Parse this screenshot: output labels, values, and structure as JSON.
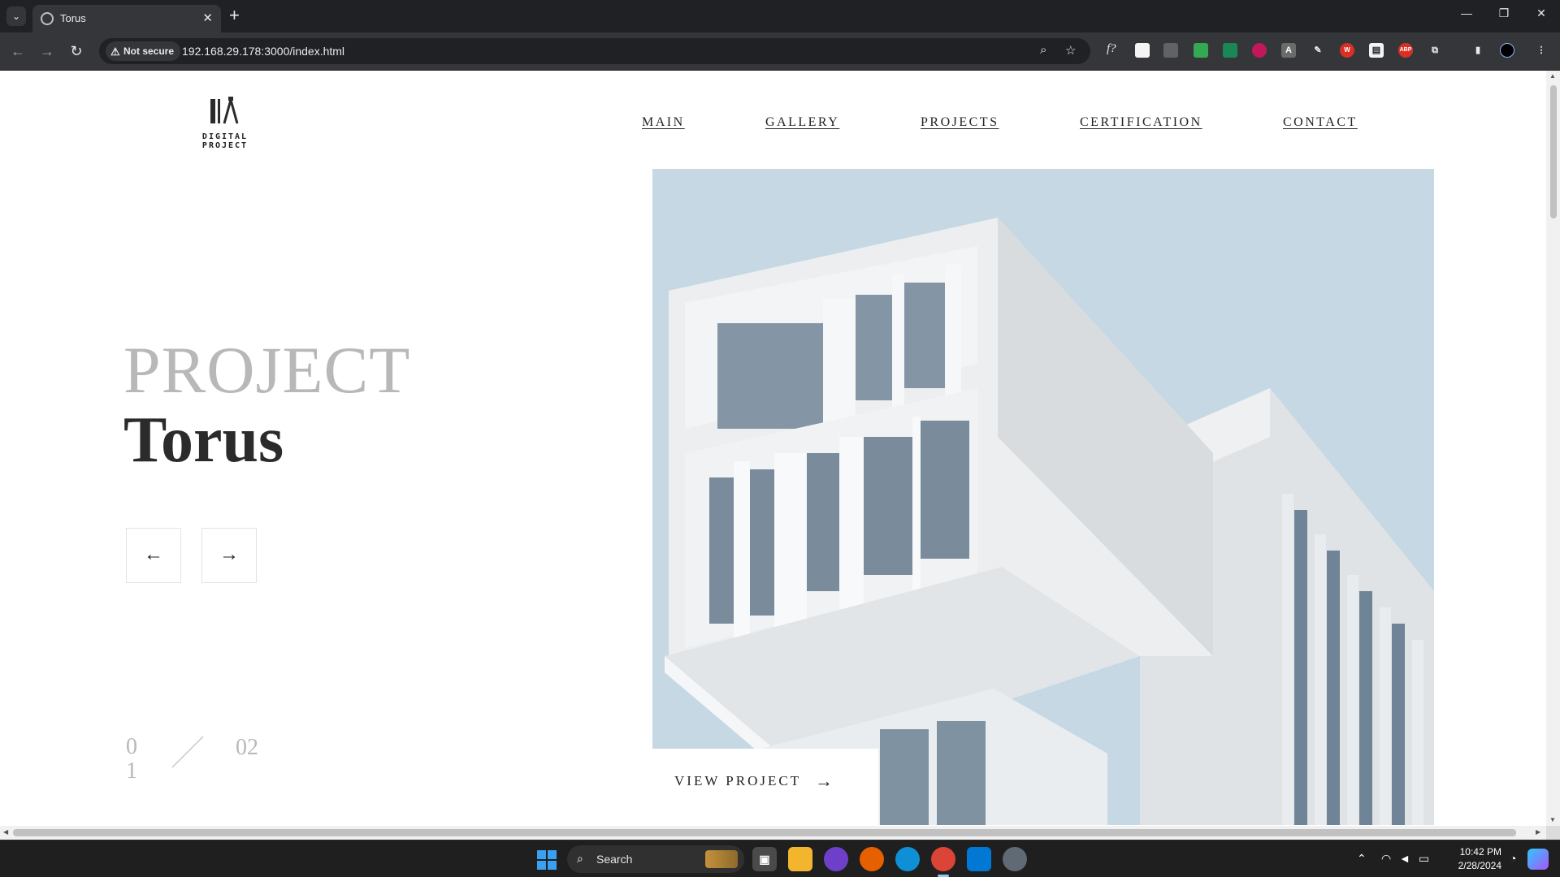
{
  "browser": {
    "tab_title": "Torus",
    "tab_close": "✕",
    "new_tab": "+",
    "not_secure_label": "Not secure",
    "url": "192.168.29.178:3000/index.html"
  },
  "site": {
    "logo_text": "DIGITAL PROJECT",
    "nav": [
      "MAIN",
      "GALLERY",
      "PROJECTS",
      "CERTIFICATION",
      "CONTACT"
    ],
    "hero_title_light": "PROJECT",
    "hero_title_bold": "Torus",
    "prev_arrow": "←",
    "next_arrow": "→",
    "view_project_label": "VIEW PROJECT",
    "view_project_arrow": "→",
    "slide_current": "01",
    "slide_total": "02"
  },
  "taskbar": {
    "search_placeholder": "Search",
    "time": "10:42 PM",
    "date": "2/28/2024"
  },
  "colors": {
    "accent_chrome": "#35363a",
    "sky": "#c6d8e4",
    "title_light": "#b8b8b8",
    "title_dark": "#2b2b2b"
  },
  "icons": [
    "tab-search-icon",
    "globe-icon",
    "back-arrow-icon",
    "forward-arrow-icon",
    "reload-icon",
    "warning-icon",
    "zoom-icon",
    "star-icon",
    "extensions-icon",
    "profile-icon",
    "windows-start-icon",
    "search-icon",
    "wifi-icon",
    "volume-icon",
    "battery-icon"
  ]
}
